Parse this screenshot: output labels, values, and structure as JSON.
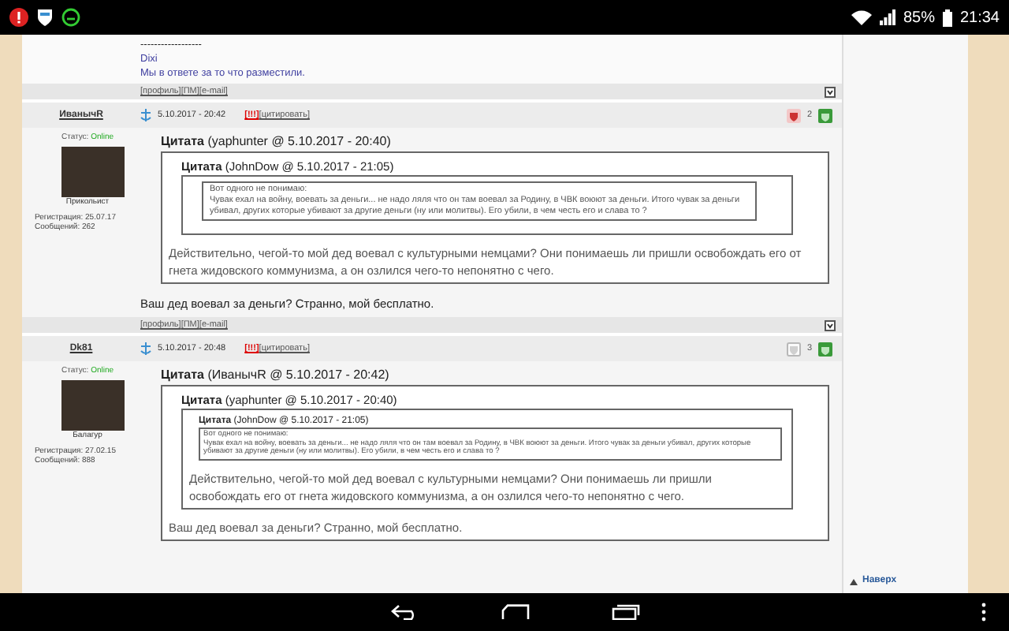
{
  "status_bar": {
    "battery": "85%",
    "time": "21:34"
  },
  "previous_post": {
    "signature": [
      "------------------",
      "Dixi",
      "Мы в ответе за то что разместили."
    ],
    "links": [
      "[профиль]",
      "[ПМ]",
      "[e-mail]"
    ]
  },
  "posts": [
    {
      "author": "ИванычR",
      "status_label": "Статус:",
      "status": "Online",
      "avatar_caption": "Прикольист",
      "registration": "Регистрация: 25.07.17",
      "messages": "Сообщений: 262",
      "date": "5.10.2017 - 20:42",
      "report": "[!!!]",
      "quote_button": "[цитировать]",
      "rating": "2",
      "vote_down_active": true,
      "quote": {
        "title": "Цитата",
        "meta": "(yaphunter @ 5.10.2017 - 20:40)",
        "quote": {
          "title": "Цитата",
          "meta": "(JohnDow @ 5.10.2017 - 21:05)",
          "text": "Вот одного не понимаю:\nЧувак ехал на войну, воевать за деньги... не надо ляля что он там воевал за Родину, в ЧВК воюют за деньги. Итого чувак за деньги убивал, других которые убивают за другие деньги (ну или молитвы).  Его убили, в чем честь его и слава то ?"
        },
        "text": "Действительно, чегой-то мой дед воевал с культурными немцами? Они понимаешь ли пришли освобождать его от гнета жидовского коммунизма, а он озлился чего-то непонятно с чего."
      },
      "text": "Ваш дед воевал за деньги? Странно, мой бесплатно.",
      "links": [
        "[профиль]",
        "[ПМ]",
        "[e-mail]"
      ]
    },
    {
      "author": "Dk81",
      "status_label": "Статус:",
      "status": "Online",
      "avatar_caption": "Балагур",
      "registration": "Регистрация: 27.02.15",
      "messages": "Сообщений: 888",
      "date": "5.10.2017 - 20:48",
      "report": "[!!!]",
      "quote_button": "[цитировать]",
      "rating": "3",
      "vote_down_active": false,
      "quote": {
        "title": "Цитата",
        "meta": "(ИванычR @ 5.10.2017 - 20:42)",
        "quote": {
          "title": "Цитата",
          "meta": "(yaphunter @ 5.10.2017 - 20:40)",
          "quote": {
            "title": "Цитата",
            "meta": "(JohnDow @ 5.10.2017 - 21:05)",
            "text": "Вот одного не понимаю:\nЧувак ехал на войну, воевать за деньги... не надо ляля что он там воевал за Родину, в ЧВК воюют за деньги. Итого чувак за деньги убивал, других которые убивают за другие деньги (ну или молитвы).  Его убили, в чем честь его и слава то ?"
          },
          "text": "Действительно, чегой-то мой дед воевал с культурными немцами? Они понимаешь ли пришли освобождать его от гнета жидовского коммунизма, а он озлился чего-то непонятно с чего."
        },
        "text": "Ваш дед воевал за деньги? Странно, мой бесплатно."
      }
    }
  ],
  "sidebar": {
    "top_link": "Наверх"
  }
}
